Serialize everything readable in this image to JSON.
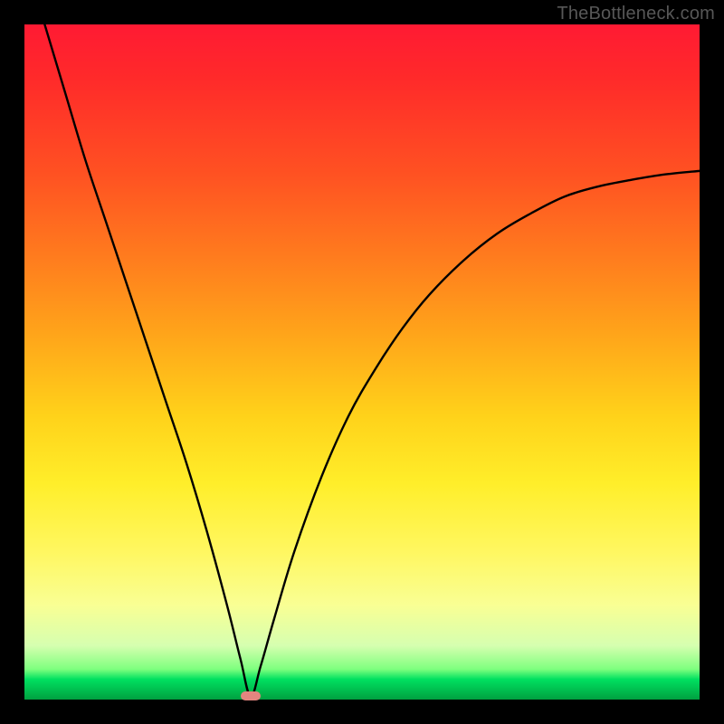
{
  "watermark": "TheBottleneck.com",
  "chart_data": {
    "type": "line",
    "title": "",
    "xlabel": "",
    "ylabel": "",
    "xlim": [
      0,
      100
    ],
    "ylim": [
      0,
      100
    ],
    "grid": false,
    "legend": false,
    "background": "rainbow_vertical_red_to_green",
    "notes": "V-shaped bottleneck curve on a red→green gradient. Axes unlabeled. Minimum near x≈33.5. Right arm rises and plateaus near y≈78 at x=100.",
    "series": [
      {
        "name": "bottleneck-curve",
        "color": "#000000",
        "x": [
          3,
          6,
          9,
          12,
          15,
          18,
          21,
          24,
          27,
          30,
          32,
          33.5,
          35,
          37,
          40,
          44,
          48,
          52,
          56,
          60,
          65,
          70,
          75,
          80,
          85,
          90,
          95,
          100
        ],
        "y": [
          100,
          90,
          80,
          71,
          62,
          53,
          44,
          35,
          25,
          14,
          6,
          0.5,
          5,
          12,
          22,
          33,
          42,
          49,
          55,
          60,
          65,
          69,
          72,
          74.5,
          76,
          77,
          77.8,
          78.3
        ]
      }
    ],
    "highlight_marker": {
      "x": 33.5,
      "y": 0.5,
      "color": "#e2857f",
      "shape": "rounded_rect"
    }
  }
}
